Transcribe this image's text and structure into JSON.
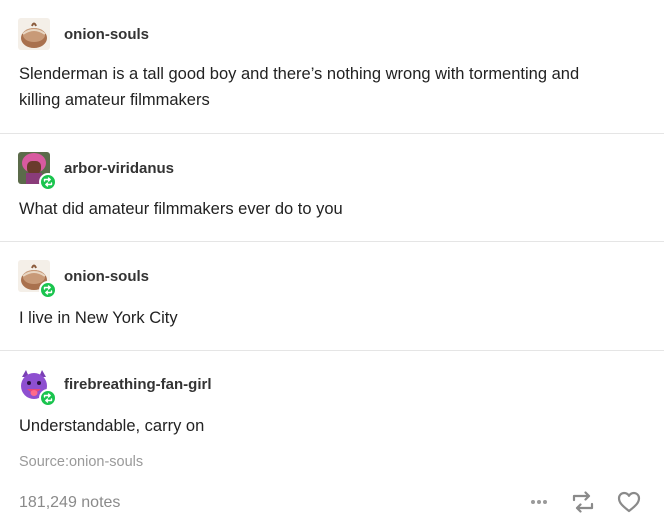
{
  "thread": [
    {
      "username": "onion-souls",
      "avatar_icon": "onion-avatar-icon",
      "reblog_badge": false,
      "text": "Slenderman is a tall good boy and there’s nothing wrong with tormenting and killing amateur filmmakers"
    },
    {
      "username": "arbor-viridanus",
      "avatar_icon": "pink-haired-character-avatar-icon",
      "reblog_badge": true,
      "text": "What did amateur filmmakers ever do to you"
    },
    {
      "username": "onion-souls",
      "avatar_icon": "onion-avatar-icon",
      "reblog_badge": true,
      "text": "I live in New York City"
    },
    {
      "username": "firebreathing-fan-girl",
      "avatar_icon": "devil-emoji-avatar-icon",
      "reblog_badge": true,
      "text": "Understandable, carry on"
    }
  ],
  "source": {
    "label": "Source:",
    "username": "onion-souls"
  },
  "footer": {
    "notes": "181,249 notes",
    "icons": [
      "more-options-icon",
      "reblog-icon",
      "heart-icon"
    ]
  },
  "colors": {
    "reblog_badge": "#1ac44e",
    "divider": "#e5e5e5",
    "muted_text": "#9a9a9a"
  }
}
